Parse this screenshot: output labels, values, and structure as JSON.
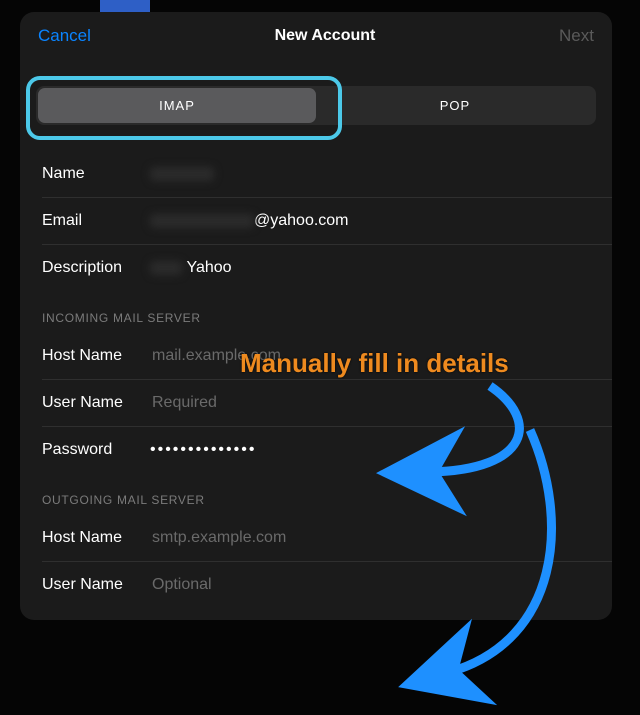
{
  "nav": {
    "cancel": "Cancel",
    "title": "New Account",
    "next": "Next"
  },
  "segmented": {
    "imap": "IMAP",
    "pop": "POP",
    "selected": "IMAP"
  },
  "account": {
    "name_label": "Name",
    "name_value": "",
    "email_label": "Email",
    "email_suffix": "@yahoo.com",
    "description_label": "Description",
    "description_suffix": "Yahoo"
  },
  "incoming": {
    "header": "INCOMING MAIL SERVER",
    "host_label": "Host Name",
    "host_placeholder": "mail.example.com",
    "user_label": "User Name",
    "user_placeholder": "Required",
    "password_label": "Password",
    "password_value": "••••••••••••••"
  },
  "outgoing": {
    "header": "OUTGOING MAIL SERVER",
    "host_label": "Host Name",
    "host_placeholder": "smtp.example.com",
    "user_label": "User Name",
    "user_placeholder": "Optional"
  },
  "annotation": "Manually fill in details"
}
